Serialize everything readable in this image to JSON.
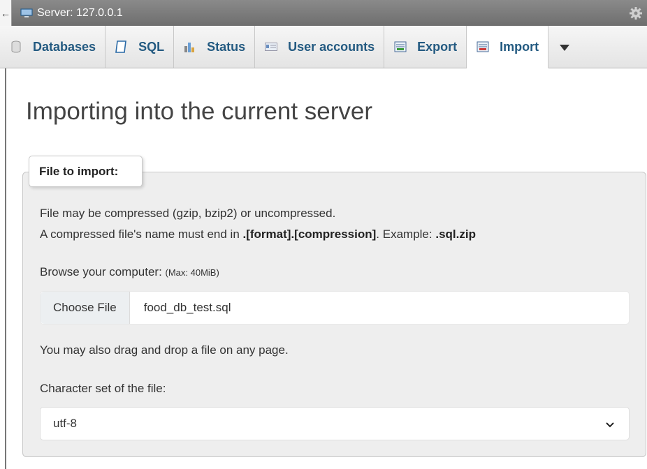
{
  "server_bar": {
    "back_symbol": "←",
    "label": "Server: 127.0.0.1",
    "icons": [
      "server-icon",
      "gear-icon"
    ]
  },
  "tabs": [
    {
      "label": "Databases",
      "icon": "database-icon"
    },
    {
      "label": "SQL",
      "icon": "sql-icon"
    },
    {
      "label": "Status",
      "icon": "status-icon"
    },
    {
      "label": "User accounts",
      "icon": "users-icon"
    },
    {
      "label": "Export",
      "icon": "export-icon"
    },
    {
      "label": "Import",
      "icon": "import-icon",
      "active": true
    }
  ],
  "page": {
    "title": "Importing into the current server"
  },
  "import_box": {
    "legend": "File to import:",
    "line1": "File may be compressed (gzip, bzip2) or uncompressed.",
    "line2_prefix": "A compressed file's name must end in ",
    "line2_bold1": ".[format].[compression]",
    "line2_mid": ". Example: ",
    "line2_bold2": ".sql.zip",
    "browse_label": "Browse your computer: ",
    "browse_max": "(Max: 40MiB)",
    "choose_file_label": "Choose File",
    "file_name": "food_db_test.sql",
    "drag_drop_note": "You may also drag and drop a file on any page.",
    "charset_label": "Character set of the file:",
    "charset_value": "utf-8"
  },
  "colors": {
    "tab_text": "#235a81",
    "server_bar": "#7a7a7a"
  }
}
